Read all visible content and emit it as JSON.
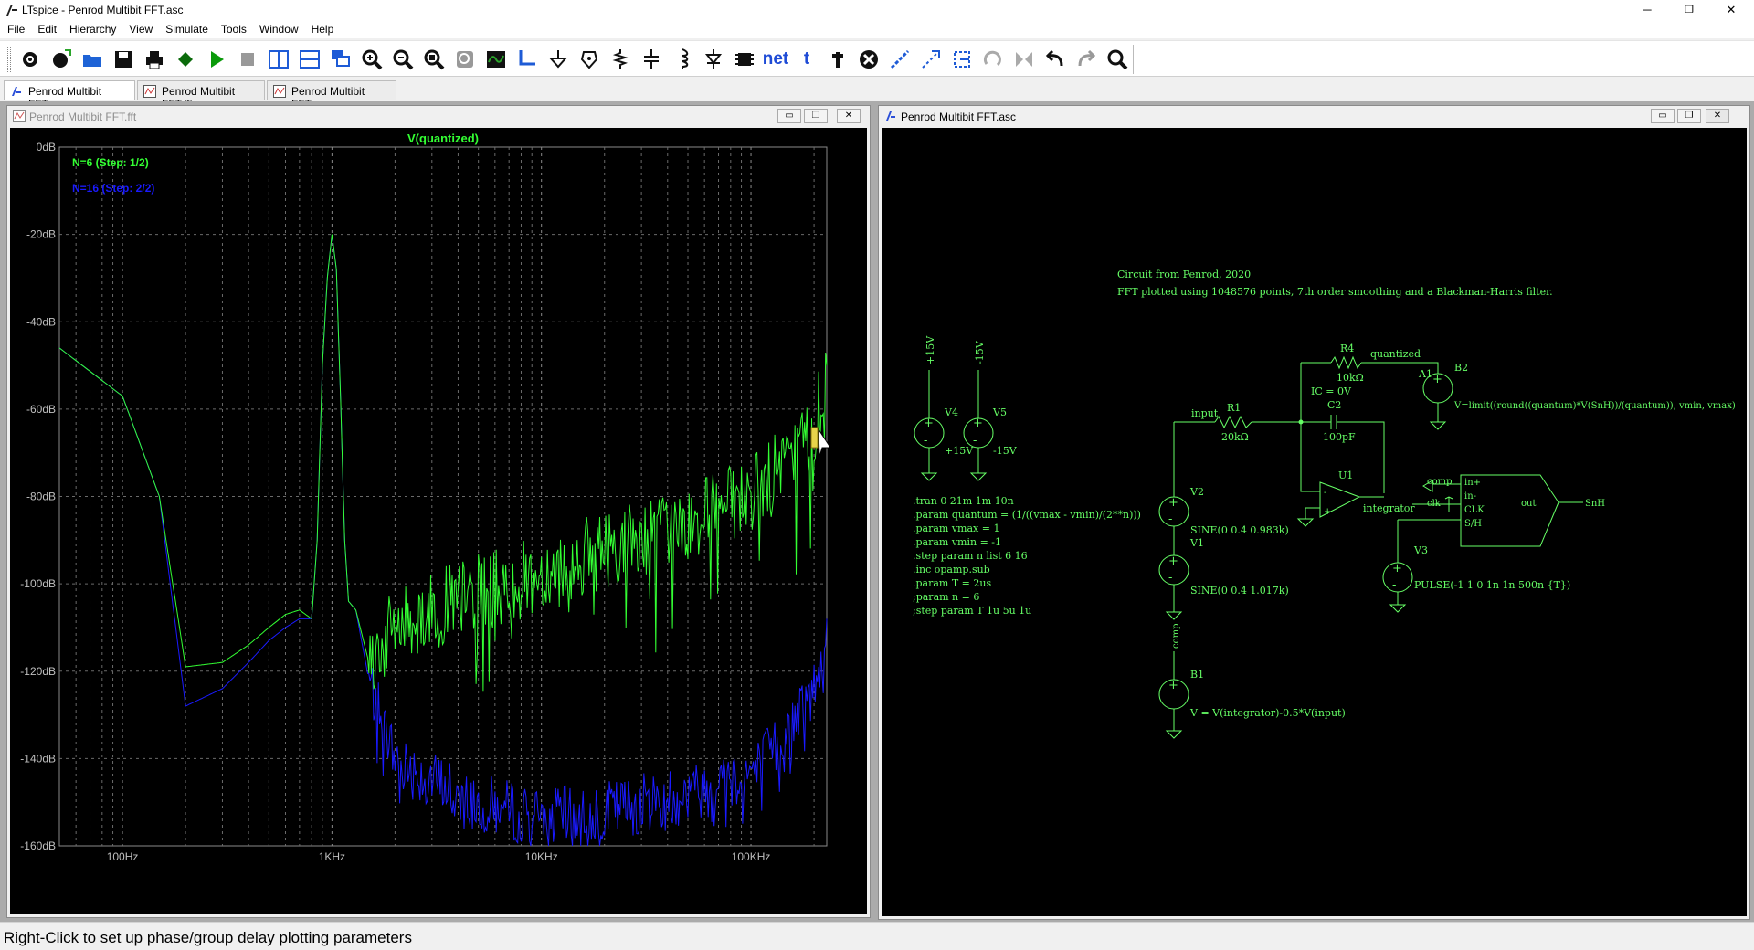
{
  "app": {
    "title": "LTspice - Penrod Multibit FFT.asc"
  },
  "window_buttons": {
    "minimize": "─",
    "maximize": "❐",
    "close": "✕"
  },
  "menu": [
    "File",
    "Edit",
    "Hierarchy",
    "View",
    "Simulate",
    "Tools",
    "Window",
    "Help"
  ],
  "toolbar": {
    "items": [
      {
        "name": "control-panel-icon"
      },
      {
        "name": "new-schematic-icon"
      },
      {
        "name": "open-icon"
      },
      {
        "name": "save-icon"
      },
      {
        "name": "print-icon"
      },
      {
        "name": "halt-icon"
      },
      {
        "name": "run-icon"
      },
      {
        "name": "stop-icon"
      },
      {
        "name": "tile-vertical-icon"
      },
      {
        "name": "tile-horizontal-icon"
      },
      {
        "name": "cascade-icon"
      },
      {
        "name": "zoom-in-icon"
      },
      {
        "name": "zoom-out-icon"
      },
      {
        "name": "zoom-full-icon"
      },
      {
        "name": "zoom-cancel-icon"
      },
      {
        "name": "autorange-icon"
      },
      {
        "name": "wire-icon"
      },
      {
        "name": "ground-icon"
      },
      {
        "name": "label-icon"
      },
      {
        "name": "resistor-icon"
      },
      {
        "name": "capacitor-icon"
      },
      {
        "name": "inductor-icon"
      },
      {
        "name": "diode-icon"
      },
      {
        "name": "component-icon"
      },
      {
        "name": "netname-icon",
        "text": "net"
      },
      {
        "name": "text-icon",
        "text": "t"
      },
      {
        "name": "spice-directive-icon"
      },
      {
        "name": "delete-icon"
      },
      {
        "name": "duplicate-icon"
      },
      {
        "name": "move-icon"
      },
      {
        "name": "drag-icon"
      },
      {
        "name": "rotate-icon"
      },
      {
        "name": "mirror-icon"
      },
      {
        "name": "undo-icon"
      },
      {
        "name": "redo-icon"
      },
      {
        "name": "find-icon"
      }
    ]
  },
  "tabs": [
    {
      "label": "Penrod Multibit FFT.asc",
      "active": true
    },
    {
      "label": "Penrod Multibit FFT.fft",
      "active": false
    },
    {
      "label": "Penrod Multibit FFT.raw",
      "active": false
    }
  ],
  "fft_window": {
    "title": "Penrod Multibit FFT.fft",
    "chart_data": {
      "type": "line",
      "title": "V(quantized)",
      "xscale": "log",
      "xlim": [
        50,
        230000
      ],
      "ylim": [
        -160,
        0
      ],
      "xticks": [
        {
          "value": 100,
          "label": "100Hz"
        },
        {
          "value": 1000,
          "label": "1KHz"
        },
        {
          "value": 10000,
          "label": "10KHz"
        },
        {
          "value": 100000,
          "label": "100KHz"
        }
      ],
      "yticks": [
        {
          "value": 0,
          "label": "0dB"
        },
        {
          "value": -20,
          "label": "-20dB"
        },
        {
          "value": -40,
          "label": "-40dB"
        },
        {
          "value": -60,
          "label": "-60dB"
        },
        {
          "value": -80,
          "label": "-80dB"
        },
        {
          "value": -100,
          "label": "-100dB"
        },
        {
          "value": -120,
          "label": "-120dB"
        },
        {
          "value": -140,
          "label": "-140dB"
        },
        {
          "value": -160,
          "label": "-160dB"
        }
      ],
      "grid": true,
      "legend_position": "top-left",
      "series": [
        {
          "name": "N=6  (Step: 1/2)",
          "color": "#33ff33",
          "x": [
            50,
            100,
            150,
            200,
            300,
            400,
            500,
            600,
            700,
            800,
            850,
            900,
            950,
            1000,
            1050,
            1100,
            1150,
            1200,
            1300,
            1500,
            2000,
            3000,
            5000,
            10000,
            20000,
            50000,
            100000,
            150000,
            200000,
            230000
          ],
          "y": [
            -46,
            -57,
            -80,
            -119,
            -118,
            -114,
            -110,
            -107,
            -106,
            -108,
            -90,
            -50,
            -30,
            -20,
            -28,
            -58,
            -90,
            -104,
            -106,
            -118,
            -110,
            -106,
            -102,
            -98,
            -92,
            -86,
            -80,
            -72,
            -64,
            -50
          ]
        },
        {
          "name": "N=16  (Step: 2/2)",
          "color": "#1a1aff",
          "x": [
            50,
            100,
            150,
            200,
            300,
            400,
            500,
            600,
            700,
            800,
            850,
            900,
            950,
            1000,
            1050,
            1100,
            1150,
            1200,
            1300,
            1500,
            2000,
            3000,
            5000,
            10000,
            20000,
            50000,
            100000,
            150000,
            200000,
            230000
          ],
          "y": [
            -46,
            -57,
            -80,
            -128,
            -124,
            -118,
            -113,
            -110,
            -108,
            -108,
            -90,
            -50,
            -30,
            -20,
            -28,
            -58,
            -90,
            -104,
            -106,
            -122,
            -140,
            -145,
            -150,
            -154,
            -152,
            -148,
            -143,
            -135,
            -124,
            -108
          ]
        }
      ]
    }
  },
  "schematic_window": {
    "title": "Penrod Multibit FFT.asc",
    "comment_lines": [
      "Circuit from Penrod, 2020",
      "FFT plotted using 1048576 points, 7th order smoothing and a Blackman-Harris filter."
    ],
    "directives": [
      ".tran 0 21m 1m 10n",
      ".param quantum = (1/((vmax - vmin)/(2**n)))",
      ".param vmax = 1",
      ".param vmin = -1",
      ".step param n list 6 16",
      ".inc opamp.sub",
      ".param T = 2us",
      ";param n = 6",
      ";step param T 1u 5u 1u"
    ],
    "labels": {
      "v4": "V4",
      "v4_val": "+15V",
      "v4_net": "+15V",
      "v5": "V5",
      "v5_val": "-15V",
      "v5_net": "-15V",
      "r1": "R1",
      "r1_val": "20kΩ",
      "input": "input",
      "r4": "R4",
      "r4_val": "10kΩ",
      "quantized": "quantized",
      "c2": "C2",
      "c2_val": "100pF",
      "ic": "IC = 0V",
      "u1": "U1",
      "integrator": "integrator",
      "b2": "B2",
      "b2_val": "V=limit((round((quantum)*V(SnH))/(quantum)), vmin, vmax)",
      "v2": "V2",
      "v2_val": "SINE(0 0.4 0.983k)",
      "v1": "V1",
      "v1_val": "SINE(0 0.4 1.017k)",
      "v3": "V3",
      "v3_val": "PULSE(-1 1 0 1n 1n 500n {T})",
      "a1": "A1",
      "a1_inp": "in+",
      "a1_inm": "in-",
      "a1_clk": "CLK",
      "a1_sh": "S/H",
      "a1_out": "out",
      "comp": "comp",
      "clk": "clk",
      "snh": "SnH",
      "b1": "B1",
      "b1_comp": "comp",
      "b1_val": "V = V(integrator)-0.5*V(input)"
    }
  },
  "status": "Right-Click to set up phase/group delay plotting parameters"
}
